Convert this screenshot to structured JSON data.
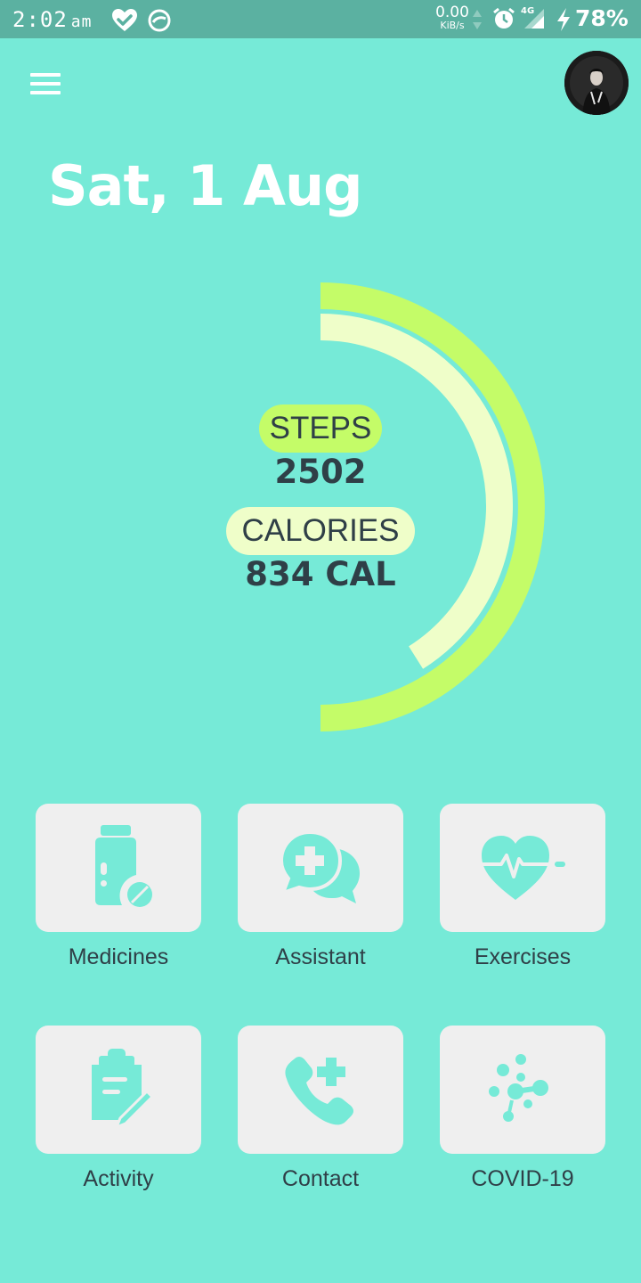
{
  "status_bar": {
    "time": "2:02",
    "ampm": "am",
    "net_speed_value": "0.00",
    "net_speed_unit": "KiB/s",
    "network_type": "4G",
    "battery": "78%"
  },
  "header": {
    "date": "Sat, 1 Aug"
  },
  "summary": {
    "steps_label": "STEPS",
    "steps_value": "2502",
    "calories_label": "CALORIES",
    "calories_value": "834 CAL"
  },
  "tiles": [
    {
      "label": "Medicines",
      "icon": "medicine-bottle-icon"
    },
    {
      "label": "Assistant",
      "icon": "chat-medical-icon"
    },
    {
      "label": "Exercises",
      "icon": "heartbeat-icon"
    },
    {
      "label": "Activity",
      "icon": "clipboard-edit-icon"
    },
    {
      "label": "Contact",
      "icon": "phone-plus-icon"
    },
    {
      "label": "COVID-19",
      "icon": "virus-icon"
    }
  ],
  "colors": {
    "background": "#76EAD7",
    "status_bar": "#5BB1A1",
    "ring_outer": "#C4FC68",
    "ring_inner": "#EFFEC9",
    "tile_background": "#EFEFEF",
    "icon": "#76EAD7",
    "text_dark": "#2F3F47"
  }
}
